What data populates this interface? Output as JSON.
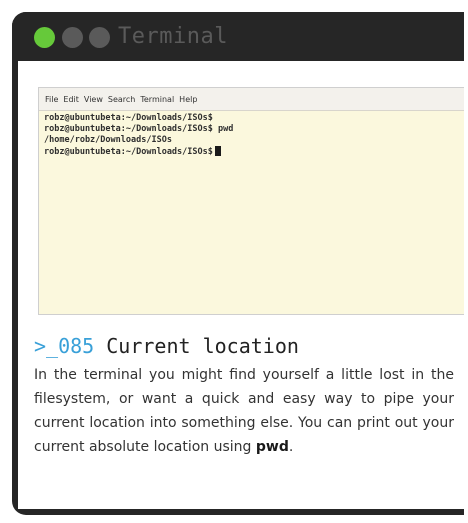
{
  "window": {
    "title": "Terminal",
    "accent_color": "#66c93a",
    "frame_color": "#262626"
  },
  "terminal": {
    "menu": [
      "File",
      "Edit",
      "View",
      "Search",
      "Terminal",
      "Help"
    ],
    "lines": [
      "robz@ubuntubeta:~/Downloads/ISOs$",
      "robz@ubuntubeta:~/Downloads/ISOs$ pwd",
      "/home/robz/Downloads/ISOs",
      "robz@ubuntubeta:~/Downloads/ISOs$"
    ],
    "background_color": "#fbf8dd"
  },
  "tip": {
    "number": ">_085",
    "title": "Current location",
    "body": "In the terminal you might find yourself a little lost in the filesystem, or want a quick and easy way to pipe your current location into something else. You can print out your current absolute location using ",
    "command": "pwd",
    "body_end": ".",
    "number_color": "#39a0d8"
  }
}
